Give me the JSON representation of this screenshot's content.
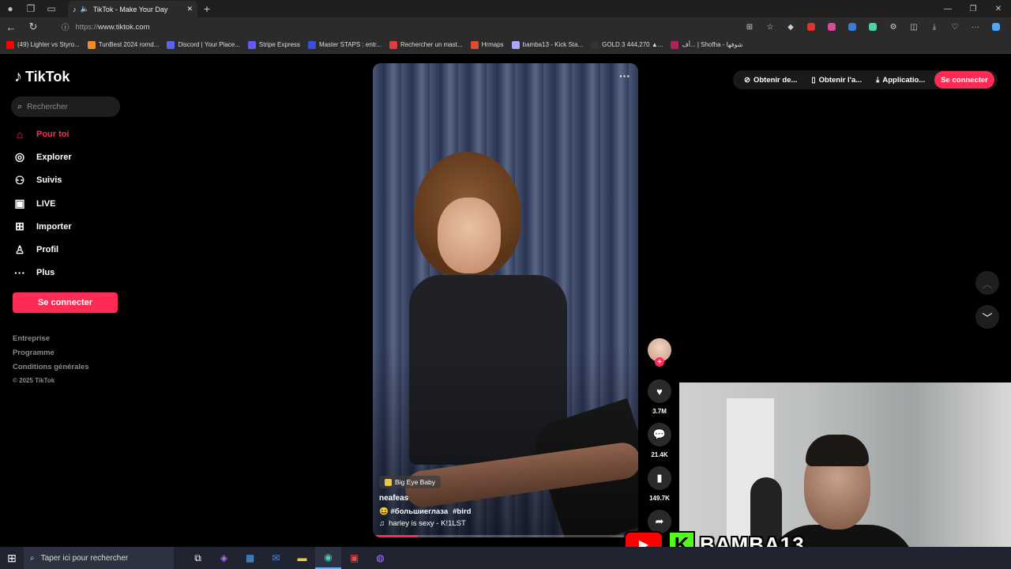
{
  "browser": {
    "tab_title": "TikTok - Make Your Day",
    "url_proto": "https://",
    "url_host": "www.tiktok.com",
    "new_tab_symbol": "+",
    "bookmarks": [
      {
        "label": "(49) Lighter vs Styro...",
        "color": "#ff0000"
      },
      {
        "label": "TunBest 2024 romd...",
        "color": "#f28b2c"
      },
      {
        "label": "Discord | Your Place...",
        "color": "#5865f2"
      },
      {
        "label": "Stripe Express",
        "color": "#635bff"
      },
      {
        "label": "Master STAPS : entr...",
        "color": "#3b4fd9"
      },
      {
        "label": "Rechercher un mast...",
        "color": "#e23b3b"
      },
      {
        "label": "Hrmaps",
        "color": "#e04b2b"
      },
      {
        "label": "bamba13 - Kick Sta...",
        "color": "#a8a8ff"
      },
      {
        "label": "GOLD 3 444,270 ▲...",
        "color": "#333333"
      },
      {
        "label": "أف... | Shofha - شوفها",
        "color": "#b0205a"
      }
    ]
  },
  "sidebar": {
    "brand": "TikTok",
    "search_placeholder": "Rechercher",
    "items": [
      {
        "label": "Pour toi",
        "icon": "home-icon",
        "glyph": "⌂"
      },
      {
        "label": "Explorer",
        "icon": "compass-icon",
        "glyph": "◎"
      },
      {
        "label": "Suivis",
        "icon": "following-icon",
        "glyph": "⚇"
      },
      {
        "label": "LIVE",
        "icon": "live-icon",
        "glyph": "▣"
      },
      {
        "label": "Importer",
        "icon": "upload-icon",
        "glyph": "⊞"
      },
      {
        "label": "Profil",
        "icon": "profile-icon",
        "glyph": "♙"
      },
      {
        "label": "Plus",
        "icon": "more-icon",
        "glyph": "···"
      }
    ],
    "login_label": "Se connecter",
    "footer_links": [
      "Entreprise",
      "Programme",
      "Conditions générales"
    ],
    "copyright": "© 2025 TikTok"
  },
  "video": {
    "badge": "Big Eye Baby",
    "author": "neafeas",
    "hashtags": [
      "😆 #большиеглаза",
      "#bird"
    ],
    "sound": "harley is sexy - K!1LST",
    "progress": 0.17
  },
  "actions": {
    "likes": "3.7M",
    "comments": "21.4K",
    "saves": "149.7K"
  },
  "topright": {
    "btn1": "Obtenir de...",
    "btn2": "Obtenir l'a...",
    "btn3": "Applicatio...",
    "login": "Se connecter"
  },
  "overlay": {
    "streamer_name": "BAMBA13",
    "kick_letter": "K"
  },
  "taskbar": {
    "search_placeholder": "Taper ici pour rechercher"
  }
}
